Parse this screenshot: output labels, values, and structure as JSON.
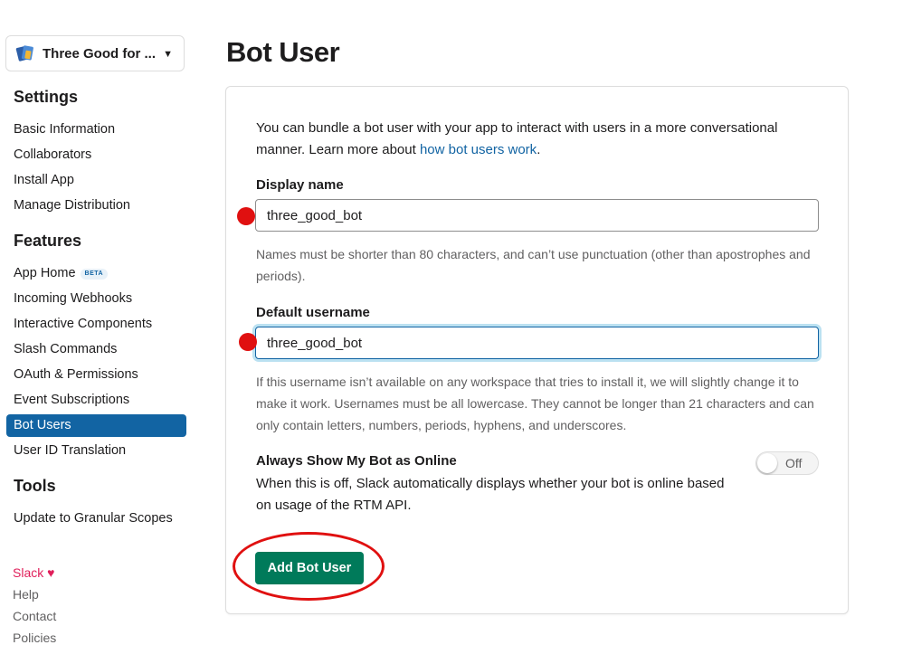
{
  "sidebar": {
    "app_switcher": {
      "app_name": "Three Good for ...",
      "icon": "app-cards-icon",
      "caret": "▼"
    },
    "settings_title": "Settings",
    "settings_items": [
      {
        "label": "Basic Information"
      },
      {
        "label": "Collaborators"
      },
      {
        "label": "Install App"
      },
      {
        "label": "Manage Distribution"
      }
    ],
    "features_title": "Features",
    "features_items": [
      {
        "label": "App Home",
        "badge": "BETA"
      },
      {
        "label": "Incoming Webhooks"
      },
      {
        "label": "Interactive Components"
      },
      {
        "label": "Slash Commands"
      },
      {
        "label": "OAuth & Permissions"
      },
      {
        "label": "Event Subscriptions"
      },
      {
        "label": "Bot Users",
        "active": true
      },
      {
        "label": "User ID Translation"
      }
    ],
    "tools_title": "Tools",
    "tools_items": [
      {
        "label": "Update to Granular Scopes"
      }
    ],
    "footer": {
      "slack": "Slack",
      "heart": "♥",
      "help": "Help",
      "contact": "Contact",
      "policies": "Policies"
    }
  },
  "main": {
    "page_title": "Bot User",
    "intro_text": "You can bundle a bot user with your app to interact with users in a more conversational manner. Learn more about ",
    "intro_link": "how bot users work",
    "intro_end": ".",
    "display_name": {
      "label": "Display name",
      "value": "three_good_bot",
      "help": "Names must be shorter than 80 characters, and can’t use punctuation (other than apostrophes and periods)."
    },
    "default_username": {
      "label": "Default username",
      "value": "three_good_bot",
      "help": "If this username isn’t available on any workspace that tries to install it, we will slightly change it to make it work. Usernames must be all lowercase. They cannot be longer than 21 characters and can only contain letters, numbers, periods, hyphens, and underscores."
    },
    "always_online": {
      "title": "Always Show My Bot as Online",
      "description": "When this is off, Slack automatically displays whether your bot is online based on usage of the RTM API.",
      "toggle_label": "Off",
      "enabled": false
    },
    "add_button_label": "Add Bot User"
  },
  "colors": {
    "accent_blue": "#1264a3",
    "button_green": "#007a5a",
    "annotation_red": "#e01010",
    "slack_pink": "#e01e5a"
  }
}
